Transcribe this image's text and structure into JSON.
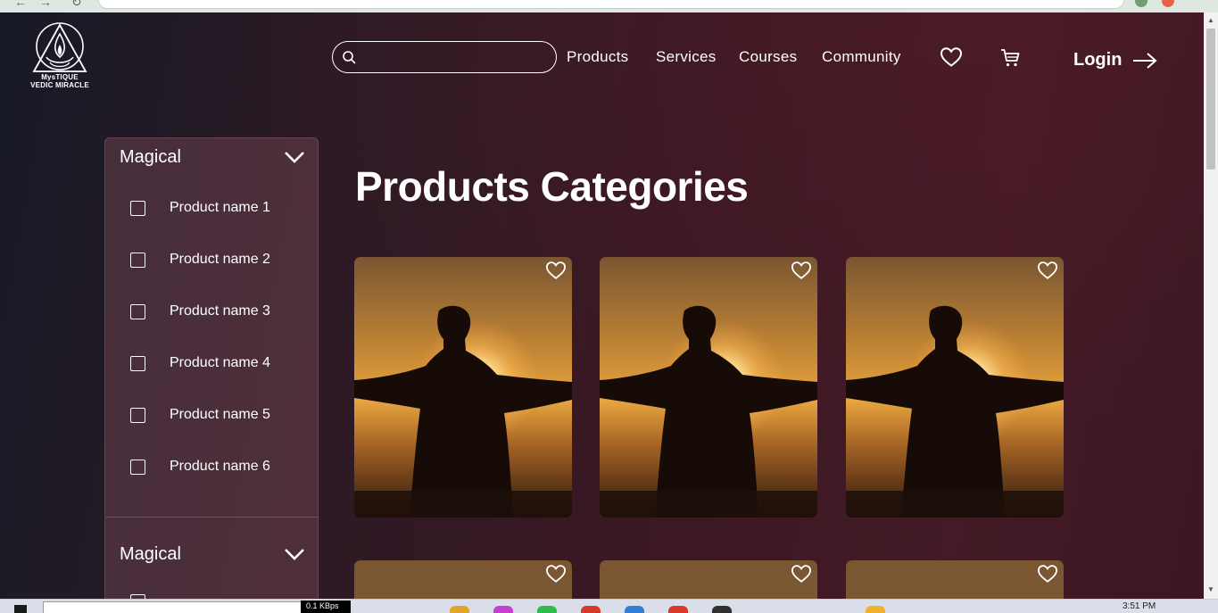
{
  "brand": {
    "logo_line1": "MysTIQUE",
    "logo_line2": "VEDIC MIRACLE"
  },
  "header": {
    "search_placeholder": "",
    "nav": [
      "Products",
      "Services",
      "Courses",
      "Community"
    ],
    "wishlist_icon": "heart-icon",
    "cart_icon": "cart-icon",
    "login_label": "Login"
  },
  "sidebar": {
    "sections": [
      {
        "title": "Magical",
        "expanded": true,
        "items": [
          "Product name 1",
          "Product name 2",
          "Product name 3",
          "Product name 4",
          "Product name 5",
          "Product name 6"
        ]
      },
      {
        "title": "Magical",
        "expanded": true
      }
    ]
  },
  "main": {
    "title": "Products Categories",
    "cards_row1": 3,
    "cards_row2": 3
  },
  "taskbar": {
    "net_speed": "0.1 KBps",
    "time": "3:51 PM"
  },
  "colors": {
    "accent": "#ffffff",
    "background_left": "#171a26",
    "background_right": "#431a25",
    "sidebar": "#5a3644"
  }
}
